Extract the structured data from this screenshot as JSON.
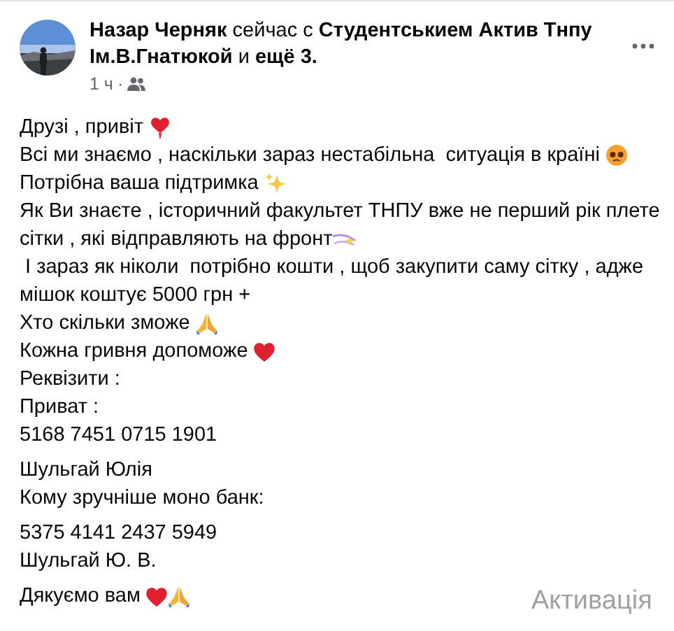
{
  "post": {
    "header": "**Назар Черняк** сейчас с **Студентськием Актив Тнпу Ім.В.Гнатюкой** и **ещё 3.**",
    "time": "1 ч",
    "separator": "·",
    "paragraphs": [
      {
        "lines": [
          "Друзі , привіт",
          "Всі ми знаємо , наскільки зараз нестабільна  ситуація в країні",
          "Потрібна ваша підтримка",
          "Як Ви знаєте , історичний факультет ТНПУ вже не перший рік плете",
          "сітки , які відправляють на фронт",
          " І зараз як ніколи  потрібно кошти , щоб закупити саму сітку , адже",
          "мішок коштує 5000 грн +",
          "Хто скільки зможе",
          "Кожна гривня допоможе",
          "Реквізити :",
          "Приват :",
          "5168 7451 0715 1901"
        ]
      },
      {
        "lines": [
          "Шульгай Юлія",
          "Кому зручніше моно банк:"
        ]
      },
      {
        "lines": [
          "5375 4141 2437 5949",
          "Шульгай Ю. В."
        ]
      },
      {
        "lines": [
          "Дякуємо вам"
        ]
      }
    ]
  },
  "os_overlay": {
    "text": "Активація"
  }
}
